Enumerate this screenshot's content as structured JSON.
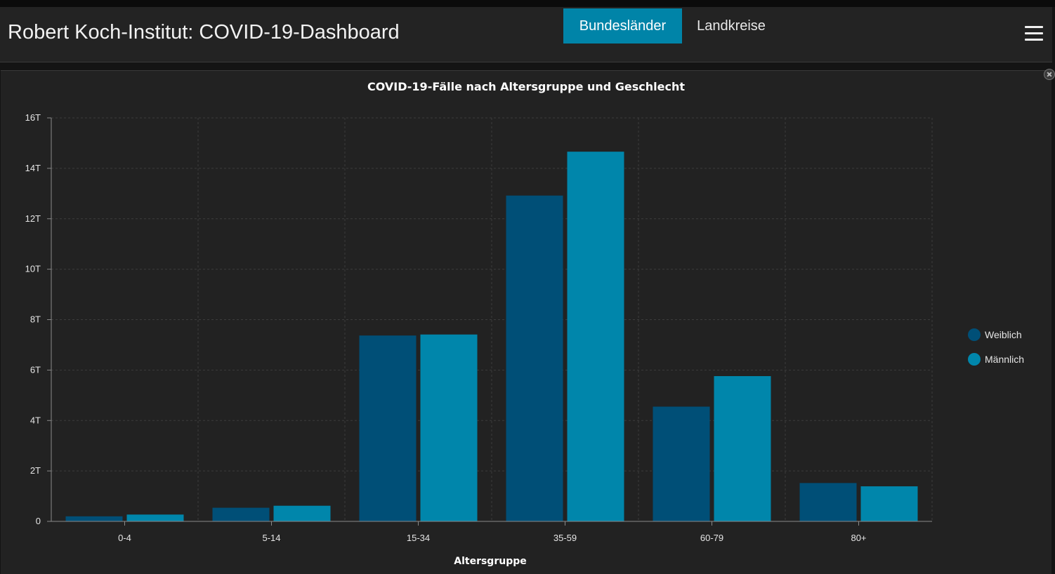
{
  "header": {
    "title": "Robert Koch-Institut: COVID-19-Dashboard",
    "tabs": [
      {
        "label": "Bundesländer",
        "active": true
      },
      {
        "label": "Landkreise",
        "active": false
      }
    ],
    "menu_icon": "hamburger-menu-icon"
  },
  "colors": {
    "accent": "#0084a8",
    "weiblich": "#004f77",
    "maennlich": "#0086ab",
    "background": "#222222"
  },
  "chart_data": {
    "type": "bar",
    "title": "COVID-19-Fälle nach Altersgruppe und Geschlecht",
    "xlabel": "Altersgruppe",
    "ylabel": "",
    "categories": [
      "0-4",
      "5-14",
      "15-34",
      "35-59",
      "60-79",
      "80+"
    ],
    "series": [
      {
        "name": "Weiblich",
        "values": [
          200,
          540,
          7370,
          12920,
          4550,
          1520
        ]
      },
      {
        "name": "Männlich",
        "values": [
          270,
          620,
          7410,
          14660,
          5760,
          1390
        ]
      }
    ],
    "ylim": [
      0,
      16000
    ],
    "y_ticks": [
      {
        "value": 0,
        "label": "0"
      },
      {
        "value": 2000,
        "label": "2T"
      },
      {
        "value": 4000,
        "label": "4T"
      },
      {
        "value": 6000,
        "label": "6T"
      },
      {
        "value": 8000,
        "label": "8T"
      },
      {
        "value": 10000,
        "label": "10T"
      },
      {
        "value": 12000,
        "label": "12T"
      },
      {
        "value": 14000,
        "label": "14T"
      },
      {
        "value": 16000,
        "label": "16T"
      }
    ],
    "grid": true,
    "legend_position": "right"
  }
}
